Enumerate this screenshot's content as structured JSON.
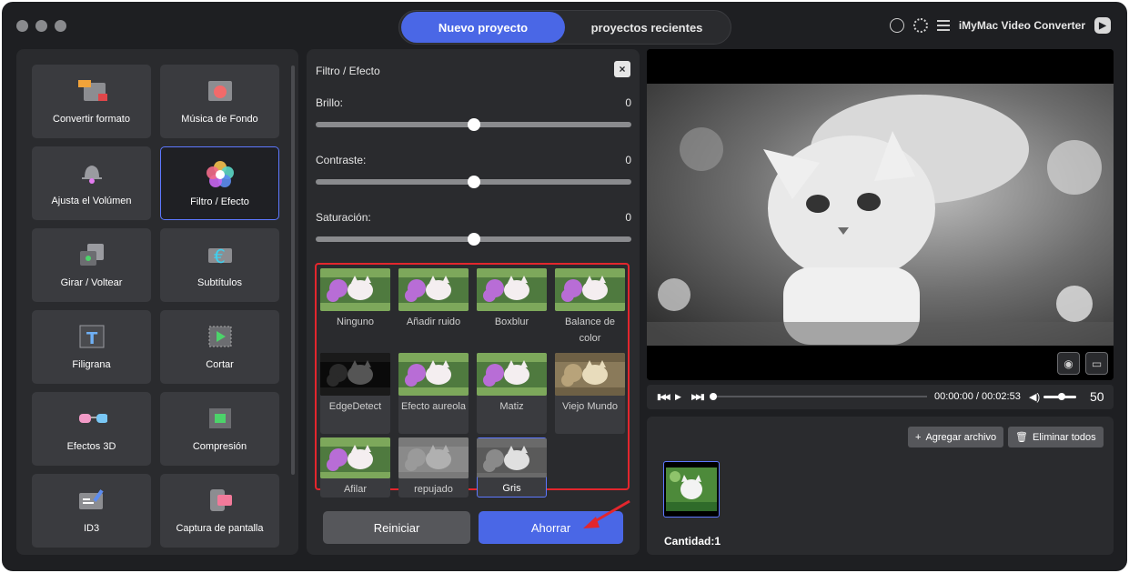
{
  "header": {
    "tabs": [
      {
        "label": "Nuevo proyecto",
        "active": true
      },
      {
        "label": "proyectos recientes",
        "active": false
      }
    ],
    "app_name": "iMyMac Video Converter",
    "accent": "#4a67e6"
  },
  "tools": [
    {
      "label": "Convertir formato",
      "icon": "convert-format-icon"
    },
    {
      "label": "Música de Fondo",
      "icon": "background-music-icon"
    },
    {
      "label": "Ajusta el Volúmen",
      "icon": "volume-bell-icon"
    },
    {
      "label": "Filtro / Efecto",
      "icon": "filter-effect-icon",
      "active": true
    },
    {
      "label": "Girar / Voltear",
      "icon": "rotate-flip-icon"
    },
    {
      "label": "Subtítulos",
      "icon": "subtitles-icon"
    },
    {
      "label": "Filigrana",
      "icon": "watermark-icon"
    },
    {
      "label": "Cortar",
      "icon": "crop-icon"
    },
    {
      "label": "Efectos 3D",
      "icon": "3d-glasses-icon"
    },
    {
      "label": "Compresión",
      "icon": "compress-icon"
    },
    {
      "label": "ID3",
      "icon": "id3-tag-icon"
    },
    {
      "label": "Captura de pantalla",
      "icon": "screen-capture-icon"
    }
  ],
  "filter_panel": {
    "title": "Filtro / Efecto",
    "close": "×",
    "sliders": [
      {
        "label": "Brillo:",
        "value": "0",
        "position": 0.5
      },
      {
        "label": "Contraste:",
        "value": "0",
        "position": 0.5
      },
      {
        "label": "Saturación:",
        "value": "0",
        "position": 0.5
      }
    ],
    "effects": [
      {
        "label": "Ninguno",
        "style": "color"
      },
      {
        "label": "Añadir ruido",
        "style": "color"
      },
      {
        "label": "Boxblur",
        "style": "color"
      },
      {
        "label": "Balance de color",
        "style": "color"
      },
      {
        "label": "EdgeDetect",
        "style": "edge"
      },
      {
        "label": "Efecto aureola",
        "style": "color"
      },
      {
        "label": "Matiz",
        "style": "color"
      },
      {
        "label": "Viejo Mundo",
        "style": "sepia"
      },
      {
        "label": "Afilar",
        "style": "color"
      },
      {
        "label": "repujado",
        "style": "emboss"
      },
      {
        "label": "Gris",
        "style": "gray",
        "active": true
      }
    ],
    "reset_label": "Reiniciar",
    "save_label": "Ahorrar"
  },
  "player": {
    "time": "00:00:00 / 00:02:53",
    "volume": "50"
  },
  "files": {
    "add_label": "Agregar archivo",
    "remove_label": "Eliminar todos",
    "count_label": "Cantidad:1"
  }
}
